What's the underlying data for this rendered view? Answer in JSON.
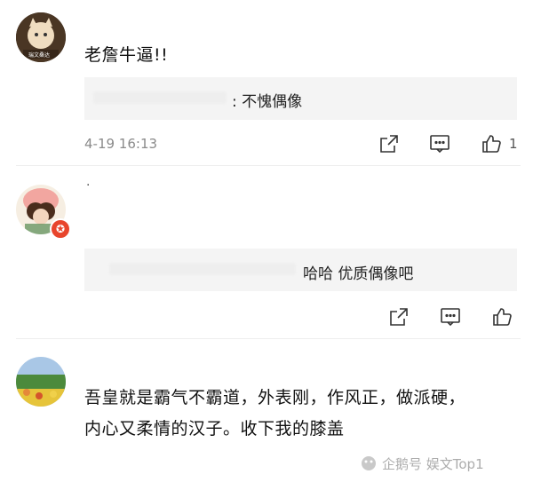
{
  "comments": [
    {
      "text": "老詹牛逼!!",
      "avatar_caption": "瑞文桑达",
      "quote": ": 不愧偶像",
      "time": "4-19 16:13",
      "like_count": "1"
    },
    {
      "text": ".",
      "avatar_badge": "✪",
      "quote": "哈哈 优质偶像吧"
    },
    {
      "text_line1": "吾皇就是霸气不霸道，外表刚，作风正，做派硬，",
      "text_line2": "内心又柔情的汉子。收下我的膝盖"
    }
  ],
  "watermark": "企鹅号 娱文Top1",
  "icons": [
    "share-icon",
    "comment-icon",
    "like-icon"
  ],
  "colors": {
    "quote_bg": "#f4f4f4",
    "meta": "#8a8a8a",
    "badge": "#e8452c"
  }
}
